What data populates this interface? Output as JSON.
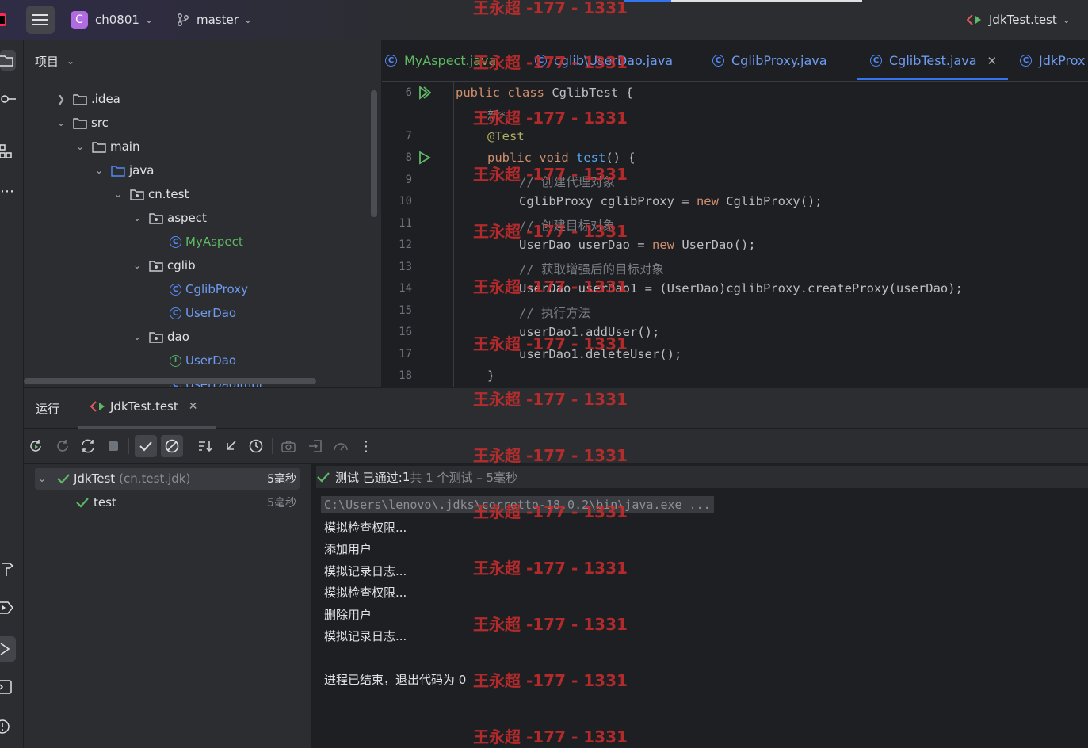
{
  "titlebar": {
    "project_badge": "C",
    "project_name": "ch0801",
    "branch": "master",
    "run_config": "JdkTest.test"
  },
  "project_panel": {
    "title": "项目",
    "tree": [
      {
        "label": ".idea",
        "kind": "folder"
      },
      {
        "label": "src",
        "kind": "folder"
      },
      {
        "label": "main",
        "kind": "folder"
      },
      {
        "label": "java",
        "kind": "source-folder"
      },
      {
        "label": "cn.test",
        "kind": "package"
      },
      {
        "label": "aspect",
        "kind": "package"
      },
      {
        "label": "MyAspect",
        "kind": "class"
      },
      {
        "label": "cglib",
        "kind": "package"
      },
      {
        "label": "CglibProxy",
        "kind": "class"
      },
      {
        "label": "UserDao",
        "kind": "class"
      },
      {
        "label": "dao",
        "kind": "package"
      },
      {
        "label": "UserDao",
        "kind": "interface"
      },
      {
        "label": "UserDaoImpl",
        "kind": "class"
      }
    ]
  },
  "editor": {
    "tabs": [
      "MyAspect.java",
      "cglib\\UserDao.java",
      "CglibProxy.java",
      "CglibTest.java",
      "JdkProx"
    ],
    "active_tab": "CglibTest.java",
    "usage_hint": "新*",
    "line_numbers": [
      "6",
      "7",
      "8",
      "9",
      "10",
      "11",
      "12",
      "13",
      "14",
      "15",
      "16",
      "17",
      "18"
    ],
    "lines": {
      "l6_kw": "public class ",
      "l6_rest": "CglibTest {",
      "l7": "@Test",
      "l8_kw": "public void ",
      "l8_fn": "test",
      "l8_rest": "() {",
      "l9": "// 创建代理对象",
      "l10_a": "CglibProxy cglibProxy = ",
      "l10_kw": "new ",
      "l10_b": "CglibProxy();",
      "l11": "// 创建目标对象",
      "l12_a": "UserDao userDao = ",
      "l12_kw": "new ",
      "l12_b": "UserDao();",
      "l13": "// 获取增强后的目标对象",
      "l14": "UserDao userDao1 = (UserDao)cglibProxy.createProxy(userDao);",
      "l15": "// 执行方法",
      "l16": "userDao1.addUser();",
      "l17": "userDao1.deleteUser();",
      "l18": "}"
    }
  },
  "run_panel": {
    "title": "运行",
    "tab_label": "JdkTest.test",
    "tree_root_label": "JdkTest",
    "tree_root_pkg": "(cn.test.jdk)",
    "tree_root_time": "5毫秒",
    "tree_child_label": "test",
    "tree_child_time": "5毫秒",
    "status_prefix": "测试 已通过: ",
    "status_count": "1",
    "status_suffix": "共 1 个测试 – 5毫秒",
    "console": {
      "command": "C:\\Users\\lenovo\\.jdks\\corretto-18.0.2\\bin\\java.exe ...",
      "lines": [
        "模拟检查权限...",
        "添加用户",
        "模拟记录日志...",
        "模拟检查权限...",
        "删除用户",
        "模拟记录日志..."
      ],
      "exit": "进程已结束，退出代码为 0"
    }
  },
  "watermark": "王永超 -177 - 1331",
  "colors": {
    "accent": "#3574f0",
    "pass": "#5fb865",
    "watermark": "#cc2d2d"
  }
}
